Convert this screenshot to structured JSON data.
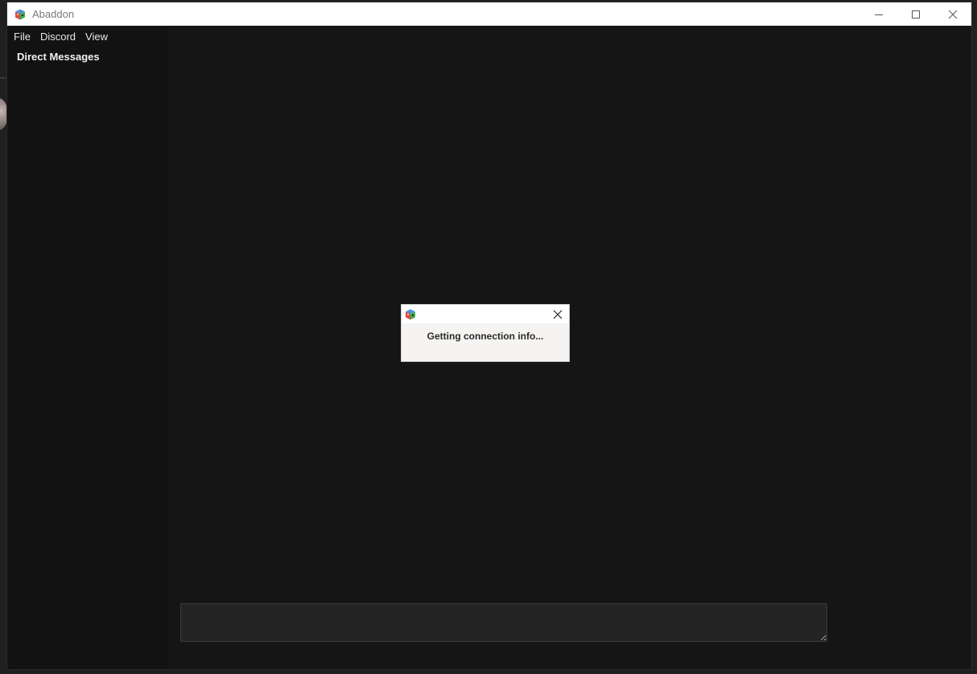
{
  "window": {
    "title": "Abaddon"
  },
  "menu": {
    "items": [
      {
        "label": "File"
      },
      {
        "label": "Discord"
      },
      {
        "label": "View"
      }
    ]
  },
  "sidebar": {
    "header": "Direct Messages"
  },
  "dialog": {
    "message": "Getting connection info..."
  },
  "colors": {
    "window_bg": "#151515",
    "sidebar_bg": "#121212",
    "titlebar_bg": "#ffffff",
    "input_bg": "#242424",
    "dialog_bg": "#f5f4f2"
  },
  "icons": {
    "app": "cube-logo-icon",
    "minimize": "minimize-icon",
    "maximize": "maximize-icon",
    "close": "close-icon"
  }
}
